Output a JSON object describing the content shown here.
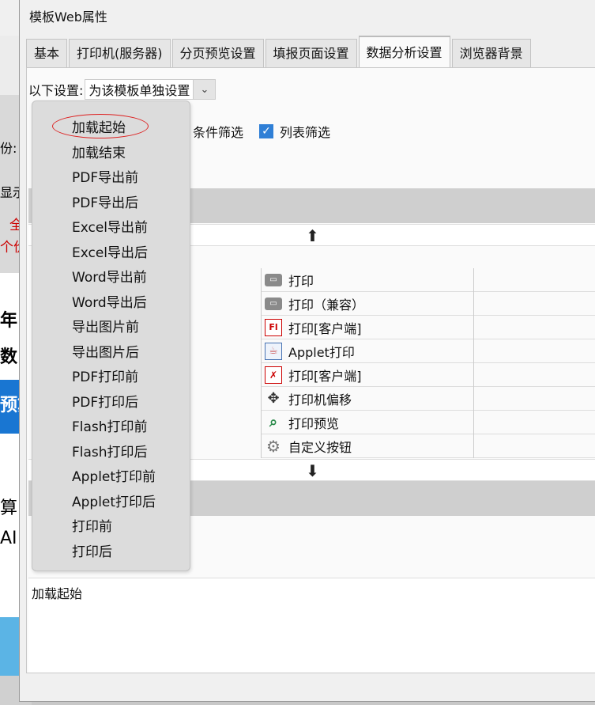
{
  "dialog": {
    "title": "模板Web属性",
    "tabs": [
      "基本",
      "打印机(服务器)",
      "分页预览设置",
      "填报页面设置",
      "数据分析设置",
      "浏览器背景"
    ],
    "active_tab": "数据分析设置"
  },
  "settings": {
    "label": "以下设置:",
    "select_value": "为该模板单独设置"
  },
  "filters": {
    "condition_label": "条件筛选",
    "list_label": "列表筛选",
    "list_checked": true
  },
  "buttons": [
    {
      "icon": "printer-icon",
      "label": "打印"
    },
    {
      "icon": "printer-icon",
      "label": "打印（兼容）"
    },
    {
      "icon": "flash-print-icon",
      "label": "打印[客户端]"
    },
    {
      "icon": "applet-icon",
      "label": "Applet打印"
    },
    {
      "icon": "pdf-icon",
      "label": "打印[客户端]"
    },
    {
      "icon": "move-icon",
      "label": "打印机偏移"
    },
    {
      "icon": "print-preview-icon",
      "label": "打印预览"
    },
    {
      "icon": "gear-icon",
      "label": "自定义按钮"
    }
  ],
  "arrows": {
    "up": "⬆",
    "down": "⬇"
  },
  "event_dropdown": {
    "items": [
      "加载起始",
      "加载结束",
      "PDF导出前",
      "PDF导出后",
      "Excel导出前",
      "Excel导出后",
      "Word导出前",
      "Word导出后",
      "导出图片前",
      "导出图片后",
      "PDF打印前",
      "PDF打印后",
      "Flash打印前",
      "Flash打印后",
      "Applet打印前",
      "Applet打印后",
      "打印前",
      "打印后"
    ],
    "highlighted": "加载起始"
  },
  "description": {
    "text": "加载起始"
  },
  "background_fragments": {
    "f1": "份:",
    "f2": "显示",
    "f3": "全",
    "f4": "个价",
    "f5": "年",
    "f6": "数",
    "f7": "预算",
    "f8": "算",
    "f9": "AI"
  },
  "colors": {
    "accent": "#2f7fd6",
    "highlight_ring": "#dd2222"
  }
}
